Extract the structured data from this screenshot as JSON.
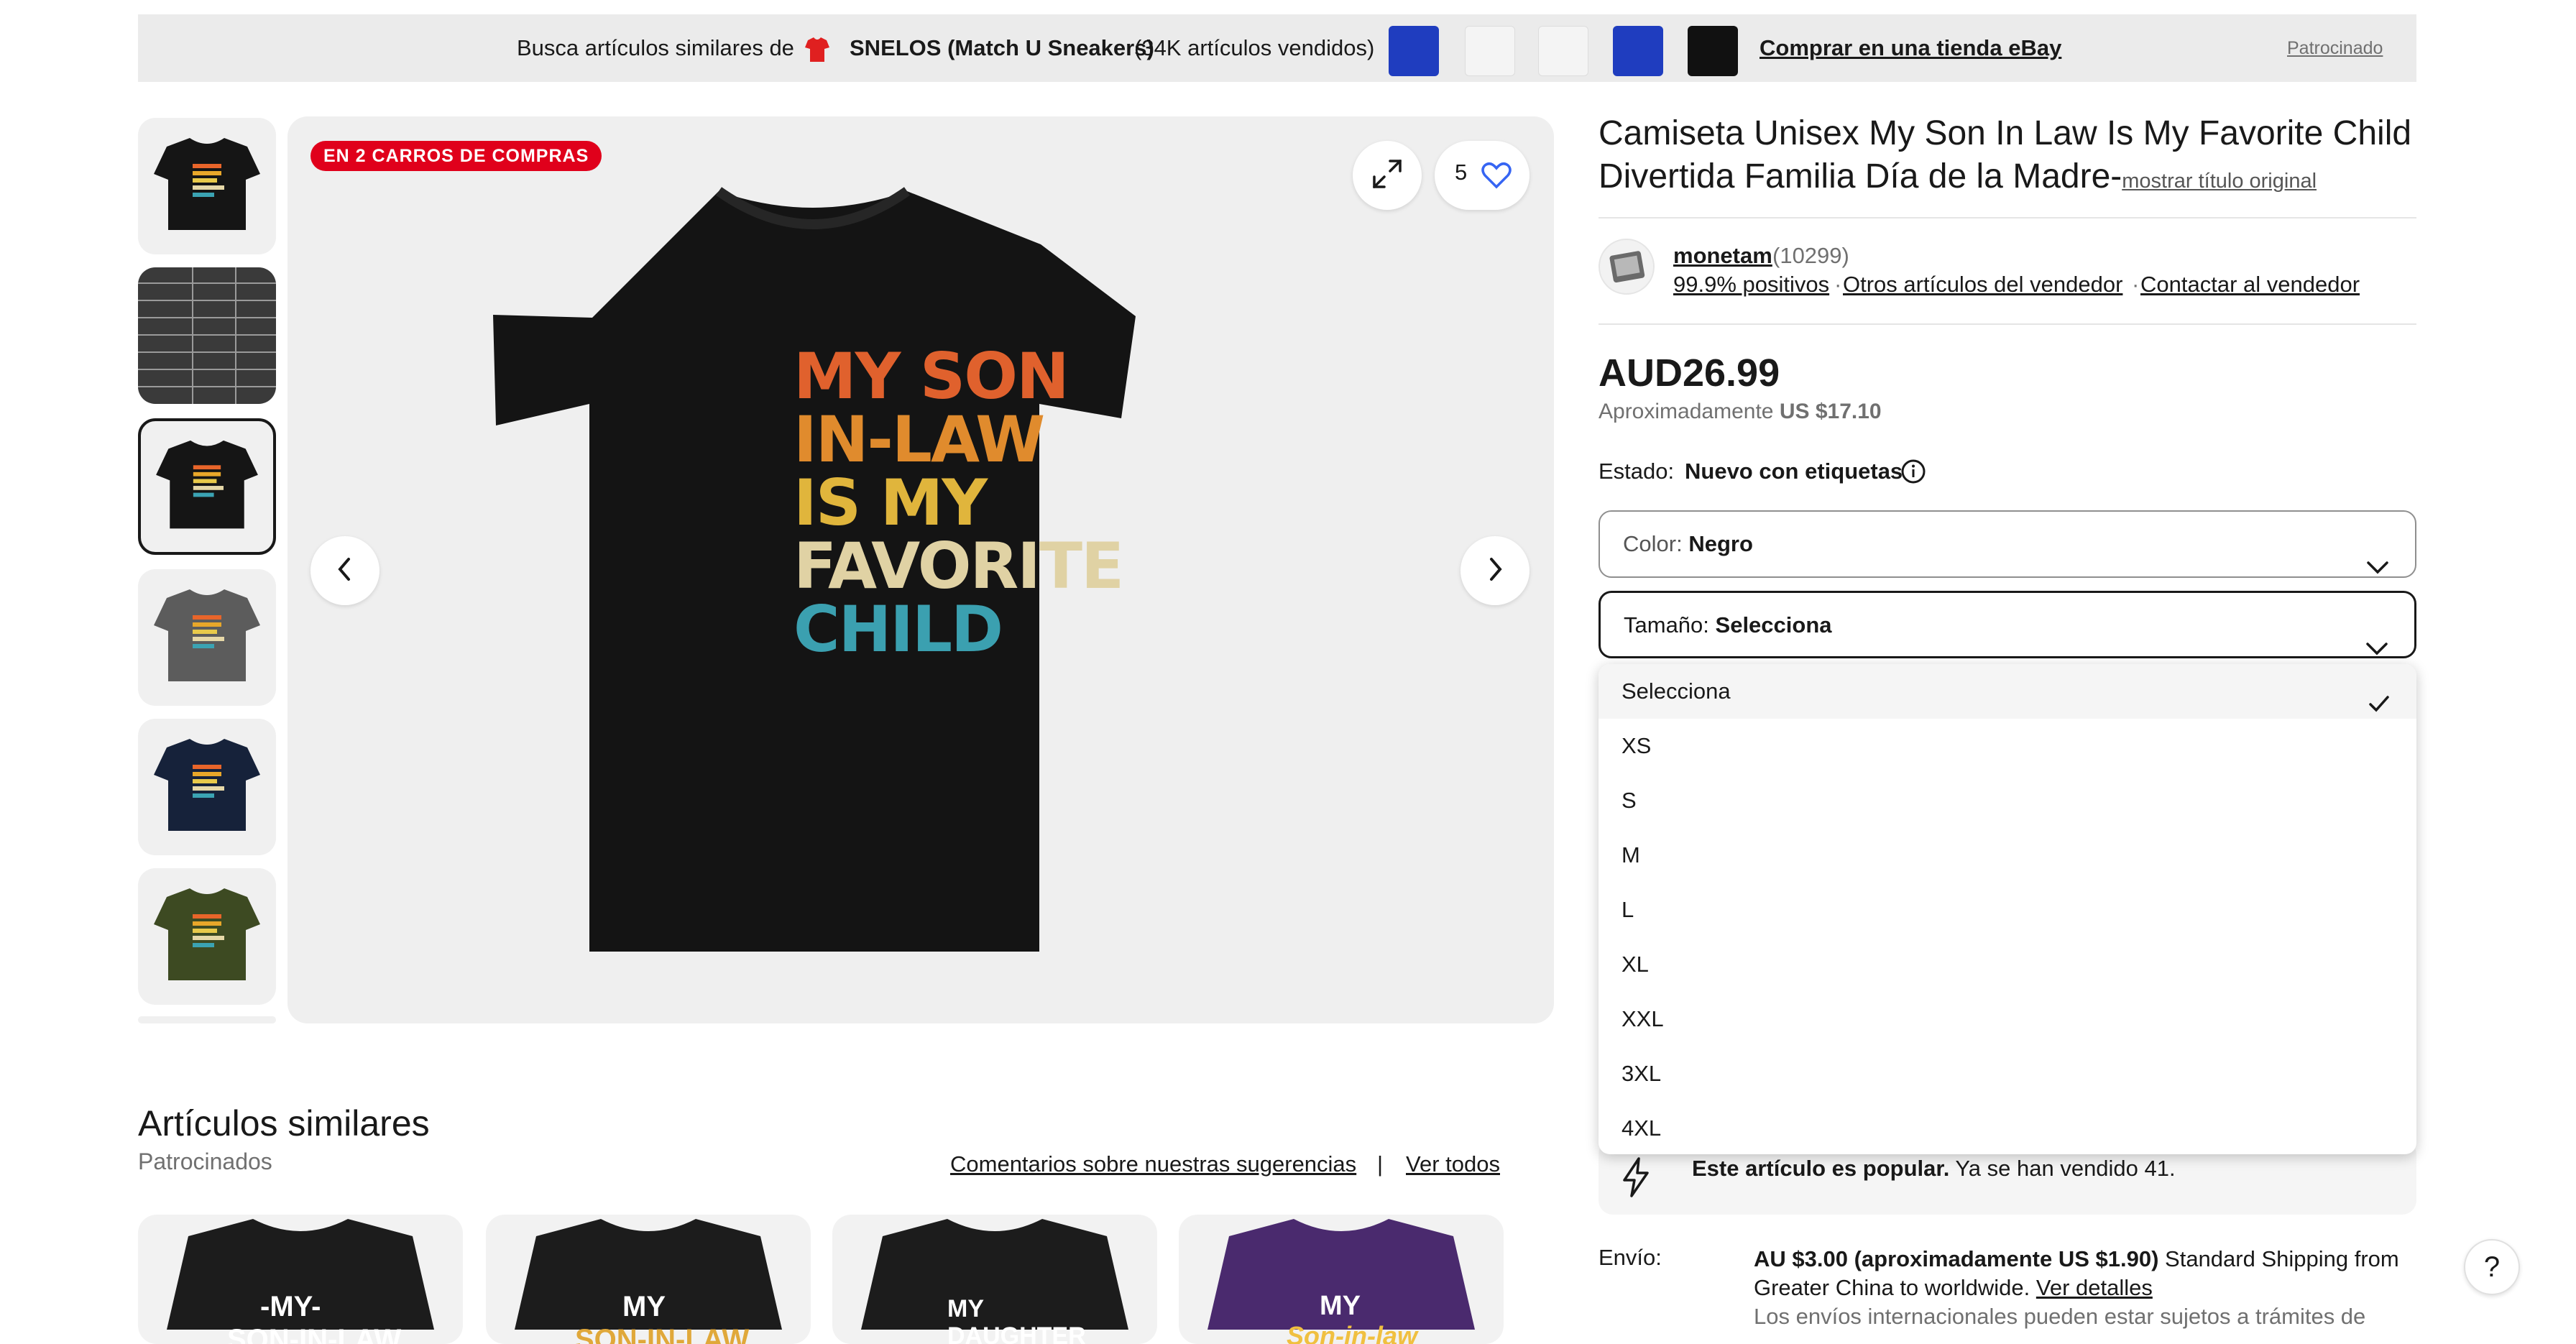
{
  "promo": {
    "prefix": "Busca artículos similares de",
    "store_name": "SNELOS (Match U Sneakers)",
    "sold": "(34K artículos vendidos)",
    "cta": "Comprar en una tienda eBay",
    "sponsored": "Patrocinado"
  },
  "gallery": {
    "cart_badge": "EN 2 CARROS DE COMPRAS",
    "watch_count": "5",
    "shirt_text": [
      "MY SON",
      "IN-LAW",
      "IS MY",
      "FAVORITE",
      "CHILD"
    ],
    "thumbnail_colors": [
      "#151515",
      "#3a3a3a",
      "#151515",
      "#5c5c5c",
      "#16223a",
      "#3d4a22"
    ]
  },
  "item": {
    "title": "Camiseta Unisex My Son In Law Is My Favorite Child Divertida Familia Día de la Madre-",
    "original_title_link": "mostrar título original",
    "seller": {
      "name": "monetam",
      "feedback_count": "(10299)",
      "positive": "99.9% positivos",
      "other_items": "Otros artículos del vendedor",
      "contact": "Contactar al vendedor"
    },
    "price": "AUD26.99",
    "approx_label": "Aproximadamente",
    "approx_value": "US $17.10",
    "condition_label": "Estado:",
    "condition_value": "Nuevo con etiquetas",
    "color_label": "Color:",
    "color_value": "Negro",
    "size_label": "Tamaño:",
    "size_value": "Selecciona",
    "size_options": [
      "Selecciona",
      "XS",
      "S",
      "M",
      "L",
      "XL",
      "XXL",
      "3XL",
      "4XL"
    ],
    "popular_bold": "Este artículo es popular.",
    "popular_rest": "Ya se han vendido 41.",
    "shipping_label": "Envío:",
    "shipping_price": "AU $3.00 (aproximadamente US $1.90)",
    "shipping_desc": "Standard Shipping from",
    "shipping_desc2": "Greater China to worldwide.",
    "shipping_details": "Ver detalles",
    "shipping_note": "Los envíos internacionales pueden estar sujetos a trámites de"
  },
  "similar": {
    "title": "Artículos similares",
    "subtitle": "Patrocinados",
    "feedback_link": "Comentarios sobre nuestras sugerencias",
    "separator": "|",
    "see_all": "Ver todos",
    "cards": [
      {
        "color": "#1c1c1c",
        "text": "-MY-",
        "text2": "SON-IN-LAW"
      },
      {
        "color": "#1c1c1c",
        "text": "MY",
        "text2": "SON-IN-LAW"
      },
      {
        "color": "#1c1c1c",
        "text": "MY",
        "text2": "DAUGHTER"
      },
      {
        "color": "#4a2a6e",
        "text": "MY",
        "text2": "Son-in-law"
      }
    ]
  },
  "help": {
    "label": "?"
  }
}
